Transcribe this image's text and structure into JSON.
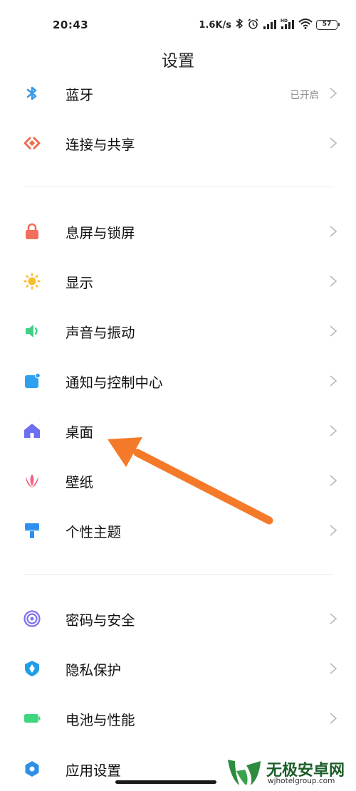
{
  "status_bar": {
    "time": "20:43",
    "net_speed": "1.6K/s",
    "battery": "57"
  },
  "header": {
    "title": "设置"
  },
  "settings": [
    {
      "id": "bluetooth",
      "label": "蓝牙",
      "value": "已开启",
      "icon": "bluetooth-icon",
      "color": "#3a9ae8"
    },
    {
      "id": "connection-sharing",
      "label": "连接与共享",
      "icon": "connection-share-icon",
      "color": "#ef6a4c"
    },
    {
      "id": "lock-screen",
      "label": "息屏与锁屏",
      "icon": "lock-icon",
      "color": "#f36e5c"
    },
    {
      "id": "display",
      "label": "显示",
      "icon": "sun-icon",
      "color": "#f7bd2e"
    },
    {
      "id": "sound-vibration",
      "label": "声音与振动",
      "icon": "speaker-icon",
      "color": "#3fcf86"
    },
    {
      "id": "notification-control",
      "label": "通知与控制中心",
      "icon": "notification-icon",
      "color": "#2ea0f0"
    },
    {
      "id": "home-screen",
      "label": "桌面",
      "icon": "home-icon",
      "color": "#6d6ef0"
    },
    {
      "id": "wallpaper",
      "label": "壁纸",
      "icon": "flower-icon",
      "color": "#f0627e"
    },
    {
      "id": "themes",
      "label": "个性主题",
      "icon": "paint-roller-icon",
      "color": "#2e8ff0"
    },
    {
      "id": "password-security",
      "label": "密码与安全",
      "icon": "fingerprint-icon",
      "color": "#7c6ef0"
    },
    {
      "id": "privacy",
      "label": "隐私保护",
      "icon": "privacy-shield-icon",
      "color": "#1f9ee8"
    },
    {
      "id": "battery-performance",
      "label": "电池与性能",
      "icon": "battery-icon",
      "color": "#3ed67e"
    },
    {
      "id": "app-settings",
      "label": "应用设置",
      "icon": "gear-icon",
      "color": "#2d8fe6"
    }
  ],
  "annotation": {
    "color": "#f47a2a"
  },
  "watermark": {
    "name": "无极安卓网",
    "url": "wjhotelgroup.com",
    "color": "#2d8a3e"
  }
}
